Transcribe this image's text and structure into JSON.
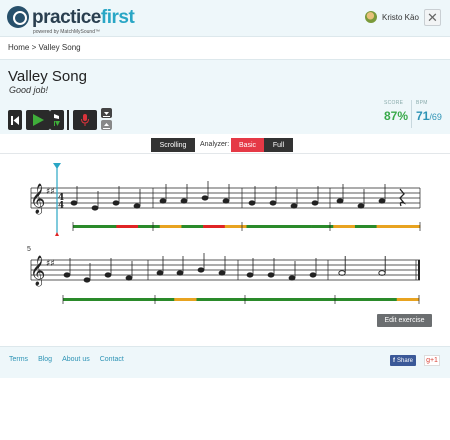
{
  "app": {
    "logo_practice": "practice",
    "logo_first": "first",
    "logo_sub": "powered by MatchMySound™"
  },
  "user": {
    "name": "Kristo Käo"
  },
  "breadcrumb": {
    "home": "Home",
    "separator": ">",
    "current": "Valley Song"
  },
  "song": {
    "title": "Valley Song",
    "subtitle": "Good job!"
  },
  "stats": {
    "score_label": "SCORE",
    "score_value": "87%",
    "bpm_label": "BPM",
    "bpm_value": "71",
    "bpm_den": "/69",
    "score_color": "#39a94a",
    "bpm_color": "#2d93b5"
  },
  "toolbar": {
    "icons": [
      "skip-back-icon",
      "play-icon",
      "metronome-icon",
      "record-icon",
      "download-icon"
    ],
    "record_color": "#d9333b",
    "play_color": "#3fae3a"
  },
  "controls": {
    "scrolling_label": "Scrolling",
    "analyzer_label": "Analyzer:",
    "basic_label": "Basic",
    "full_label": "Full",
    "basic_color": "#e53946"
  },
  "sheet": {
    "measure_number_2": "5",
    "colors": {
      "green": "#2a8a2a",
      "red": "#e02424",
      "orange": "#e8a320"
    },
    "line1_feedback": [
      "green",
      "green",
      "red",
      "green",
      "orange",
      "green",
      "red",
      "orange",
      "green",
      "green",
      "green",
      "green",
      "orange",
      "green",
      "orange",
      "orange"
    ],
    "line2_feedback": [
      "green",
      "green",
      "green",
      "green",
      "green",
      "orange",
      "green",
      "green",
      "green",
      "green",
      "green",
      "green",
      "green",
      "green",
      "green",
      "orange"
    ]
  },
  "edit_button": "Edit exercise",
  "footer": {
    "links": [
      "Terms",
      "Blog",
      "About us",
      "Contact"
    ],
    "share_label": "Share",
    "gplus_label": "g+1"
  }
}
